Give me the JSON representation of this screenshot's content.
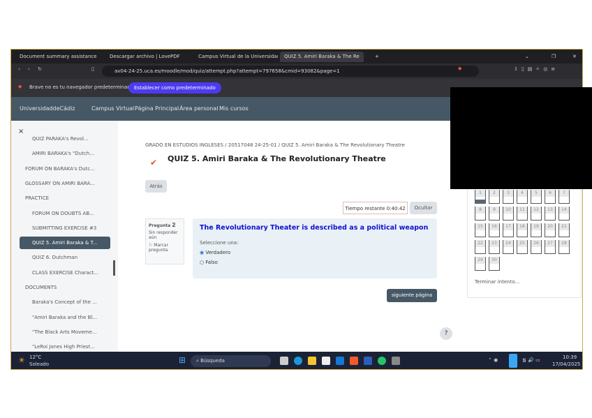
{
  "tabs": [
    "Document summary assistance",
    "Descargar archivo | LovePDF",
    "Campus Virtual de la Universidad d",
    "QUIZ 5. Amiri Baraka & The Re"
  ],
  "url": "av04-24-25.uca.es/moodle/mod/quiz/attempt.php?attempt=797658&cmid=93082&page=1",
  "infobar": {
    "text": "Brave no es tu navegador predeterminado",
    "button": "Establecer como predeterminado"
  },
  "moodle_nav": {
    "brand": "UniversidaddeCádiz",
    "items": [
      "Campus Virtual",
      "Página Principal",
      "Área personal",
      "Mis cursos"
    ]
  },
  "sidebar": {
    "close": "×",
    "items": [
      {
        "label": "QUIZ PARAKA's Revol...",
        "sub": true
      },
      {
        "label": "AMIRI BARAKA's \"Dutch...",
        "sub": true
      },
      {
        "label": "FORUM ON BARAKA's Dutc...",
        "sub": false
      },
      {
        "label": "GLOSSARY ON AMIRI BARA...",
        "sub": false
      },
      {
        "label": "PRACTICE",
        "sub": false
      },
      {
        "label": "FORUM ON DOUBTS AB...",
        "sub": true
      },
      {
        "label": "SUBMITTING EXERCISE #3",
        "sub": true
      },
      {
        "label": "QUIZ 5. Amiri Baraka & T...",
        "sub": true,
        "active": true
      },
      {
        "label": "QUIZ 6. Dutchman",
        "sub": true
      },
      {
        "label": "CLASS EXERCISE Charact...",
        "sub": true
      },
      {
        "label": "DOCUMENTS",
        "sub": false
      },
      {
        "label": "Baraka's Concept of the ...",
        "sub": true
      },
      {
        "label": "\"Amiri Baraka and the Bl...",
        "sub": true
      },
      {
        "label": "\"The Black Arts Moveme...",
        "sub": true
      },
      {
        "label": "\"LeRoi Jones High Priest...",
        "sub": true
      }
    ]
  },
  "breadcrumb": "GRADO EN ESTUDIOS INGLESES / 20517048 24-25-01 / QUIZ 5. Amiri Baraka & The Revolutionary Theatre",
  "title": "QUIZ 5. Amiri Baraka & The Revolutionary Theatre",
  "back": "Atrás",
  "timer": "Tiempo restante 0:40:42",
  "hide": "Ocultar",
  "qinfo": {
    "label": "Pregunta",
    "number": "2",
    "status": "Sin responder aún",
    "flag": "Marcar pregunta"
  },
  "question": {
    "text": "The Revolutionary Theater is described as a political weapon",
    "prompt": "Seleccione una:",
    "options": [
      "Verdadero",
      "Falso"
    ],
    "selected": 0
  },
  "next": "siguiente página",
  "help": "?",
  "quiznav": {
    "numbers": [
      "1",
      "2",
      "3",
      "4",
      "5",
      "6",
      "7",
      "8",
      "9",
      "10",
      "11",
      "12",
      "13",
      "14",
      "15",
      "16",
      "17",
      "18",
      "19",
      "20",
      "21",
      "22",
      "23",
      "24",
      "25",
      "26",
      "27",
      "28",
      "29",
      "30"
    ],
    "finish": "Terminar intento..."
  },
  "taskbar": {
    "temp": "12°C",
    "weather": "Soleado",
    "search": "Búsqueda",
    "time": "10:39",
    "date": "17/04/2025"
  }
}
